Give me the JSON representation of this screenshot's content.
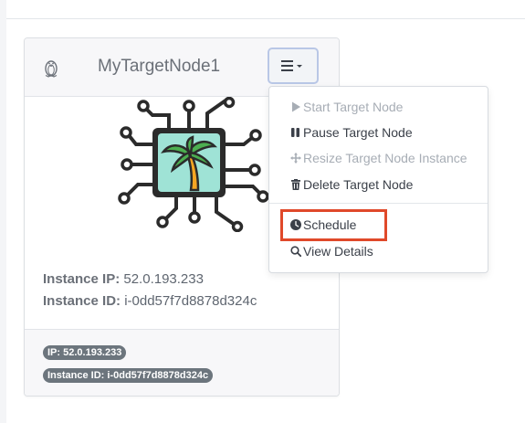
{
  "node": {
    "title": "MyTargetNode1",
    "os_icon": "linux-tux-icon",
    "menu_icon": "hamburger-icon"
  },
  "instance": {
    "ip_label": "Instance IP:",
    "ip_value": "52.0.193.233",
    "id_label": "Instance ID:",
    "id_value": "i-0dd57f7d8878d324c"
  },
  "footer": {
    "ip_badge": "IP: 52.0.193.233",
    "id_badge": "Instance ID: i-0dd57f7d8878d324c"
  },
  "menu": {
    "items": [
      {
        "label": "Start Target Node",
        "icon": "play-icon",
        "enabled": false
      },
      {
        "label": "Pause Target Node",
        "icon": "pause-icon",
        "enabled": true
      },
      {
        "label": "Resize Target Node Instance",
        "icon": "arrows-move-icon",
        "enabled": false
      },
      {
        "label": "Delete Target Node",
        "icon": "trash-icon",
        "enabled": true
      },
      {
        "label": "Schedule",
        "icon": "clock-icon",
        "enabled": true,
        "highlighted": true
      },
      {
        "label": "View Details",
        "icon": "search-icon",
        "enabled": true
      }
    ]
  },
  "colors": {
    "highlight": "#e0492a",
    "chip_fill": "#9fe3d6",
    "palm_green": "#4caf50",
    "palm_trunk": "#f5a623"
  }
}
